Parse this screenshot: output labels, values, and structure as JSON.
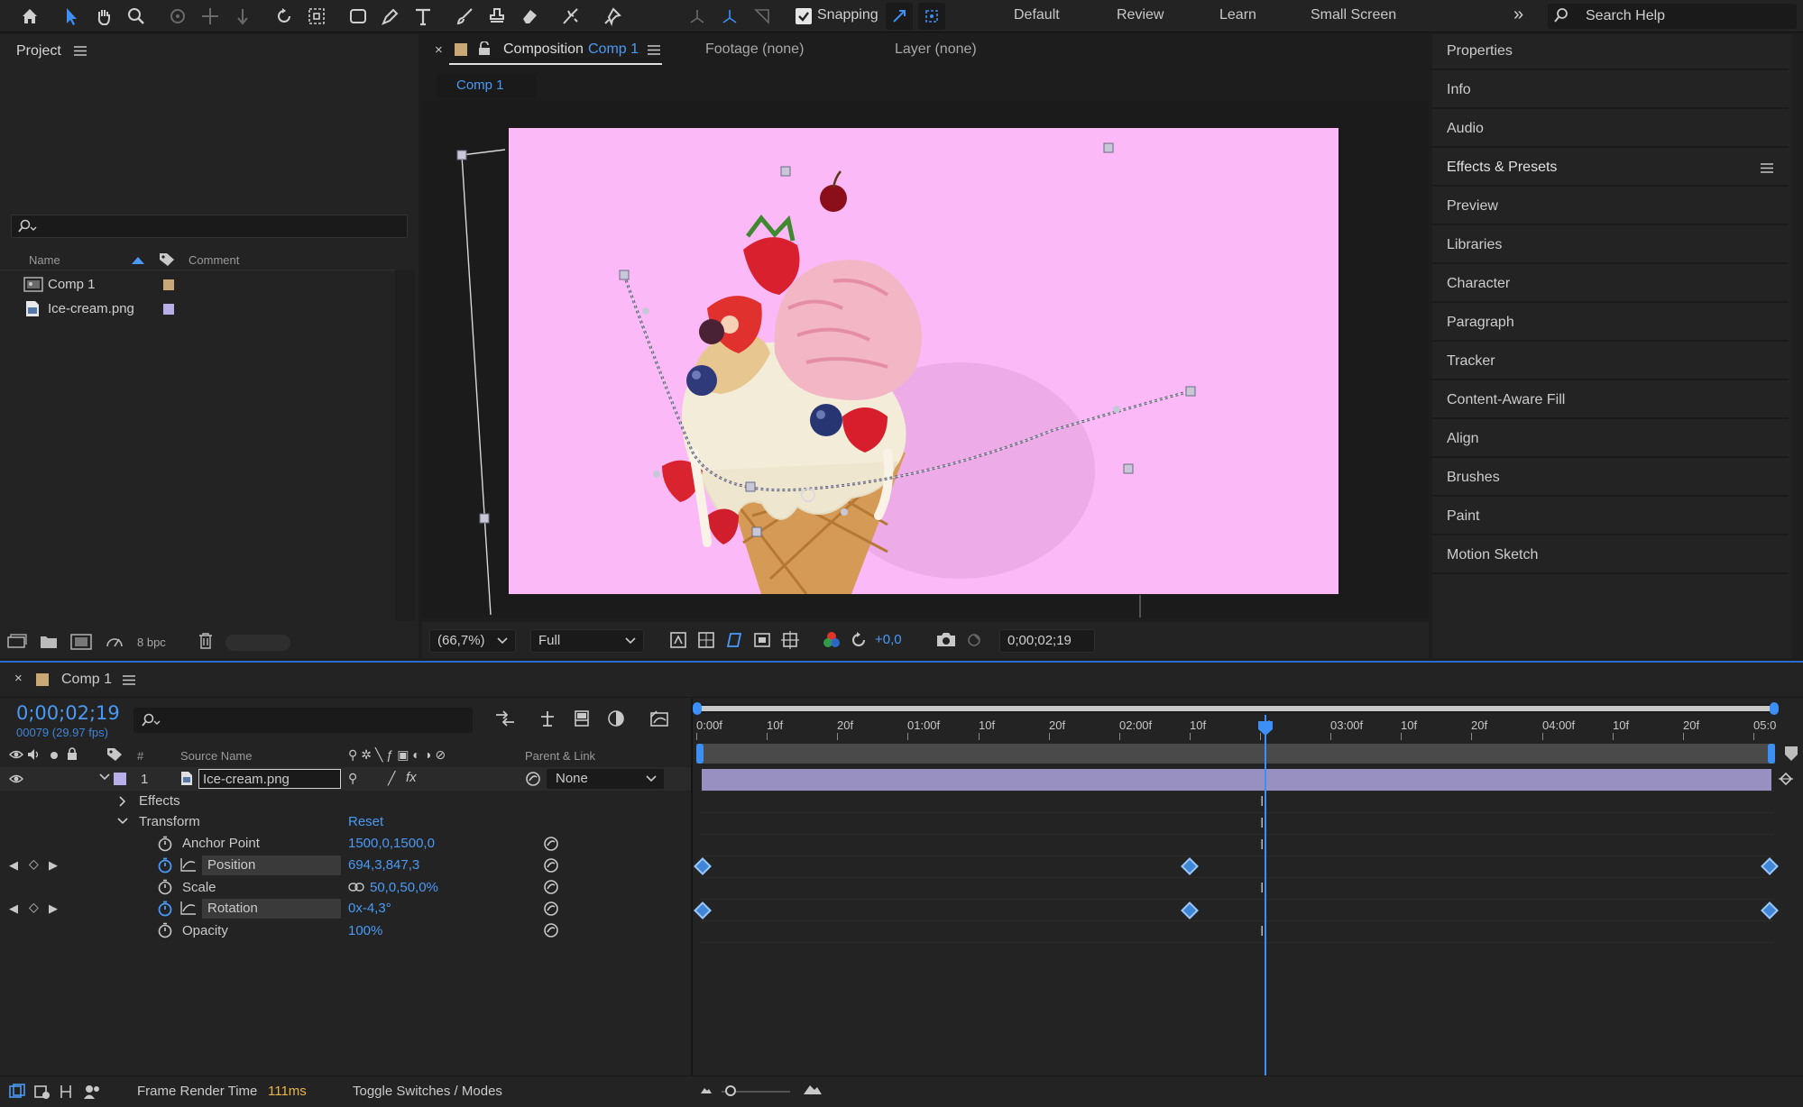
{
  "toolbar": {
    "snapping_label": "Snapping",
    "workspaces": [
      "Default",
      "Review",
      "Learn",
      "Small Screen"
    ],
    "search_placeholder": "Search Help",
    "tools": [
      "home-icon",
      "selection-icon",
      "hand-icon",
      "zoom-icon",
      "orbit-icon",
      "pan-icon",
      "dolly-icon",
      "rotate-icon",
      "pan-behind-icon",
      "rectangle-icon",
      "pen-icon",
      "type-icon",
      "brush-icon",
      "clone-stamp-icon",
      "eraser-icon",
      "roto-brush-icon",
      "puppet-pin-icon"
    ]
  },
  "project": {
    "title": "Project",
    "search_placeholder": "",
    "columns": {
      "name": "Name",
      "comment": "Comment"
    },
    "items": [
      {
        "name": "Comp 1",
        "type": "composition",
        "label_color": "#c9a878"
      },
      {
        "name": "Ice-cream.png",
        "type": "footage",
        "label_color": "#b7b0e8"
      }
    ],
    "bpc": "8 bpc"
  },
  "viewer": {
    "tabs": {
      "composition_prefix": "Composition",
      "composition_name": "Comp 1",
      "footage": "Footage (none)",
      "layer": "Layer (none)"
    },
    "comp_tab": "Comp 1",
    "zoom": "(66,7%)",
    "resolution": "Full",
    "exposure": "+0,0",
    "timecode": "0;00;02;19",
    "background_color": "#fbb9f7"
  },
  "right_panels": {
    "items": [
      "Properties",
      "Info",
      "Audio",
      "Effects & Presets",
      "Preview",
      "Libraries",
      "Character",
      "Paragraph",
      "Tracker",
      "Content-Aware Fill",
      "Align",
      "Brushes",
      "Paint",
      "Motion Sketch"
    ]
  },
  "timeline": {
    "comp_name": "Comp 1",
    "timecode": "0;00;02;19",
    "frames_fps": "00079 (29.97 fps)",
    "columns": {
      "num": "#",
      "source": "Source Name",
      "parent": "Parent & Link"
    },
    "ruler": [
      "0:00f",
      "10f",
      "20f",
      "01:00f",
      "10f",
      "20f",
      "02:00f",
      "10f",
      "0f",
      "03:00f",
      "10f",
      "20f",
      "04:00f",
      "10f",
      "20f",
      "05:0"
    ],
    "layer": {
      "num": "1",
      "name": "Ice-cream.png",
      "parent": "None"
    },
    "groups": {
      "effects": "Effects",
      "transform": "Transform",
      "reset": "Reset"
    },
    "properties": [
      {
        "name": "Anchor Point",
        "value": "1500,0,1500,0",
        "keyframed": false
      },
      {
        "name": "Position",
        "value": "694,3,847,3",
        "keyframed": true
      },
      {
        "name": "Scale",
        "value": "50,0,50,0%",
        "keyframed": false
      },
      {
        "name": "Rotation",
        "value": "0x-4,3°",
        "keyframed": true
      },
      {
        "name": "Opacity",
        "value": "100%",
        "keyframed": false
      }
    ],
    "footer": {
      "render_label": "Frame Render Time",
      "render_value": "111ms",
      "toggle": "Toggle Switches / Modes"
    },
    "accent_color": "#4a9af5"
  }
}
